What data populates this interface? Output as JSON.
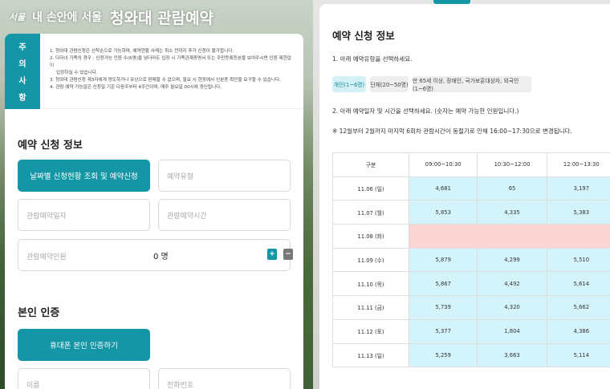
{
  "header": {
    "logo_mark": "서울",
    "logo_text": "내 손안에 서울",
    "page_title": "청와대 관람예약"
  },
  "notice": {
    "tab_chars": [
      "주",
      "의",
      "사",
      "항"
    ],
    "items": [
      "1. 청와대 관람신청은 선착순으로 가능하며, 예약현황 사례는 취소 전까지 추가 신청이 불가합니다.",
      "2. 다자녀 가족의 경우 : 신청가능 인원 수(6명)을 넘더라도 입장 시 가족관계증명서 또는 주민등록등본을 보여주시면 인원 제한없이",
      "입장하실 수 있습니다.",
      "3. 청와대 관람신청 제3자에게 양도하거나 유상으로 판매할 수 없으며, 필요 시 현장에서 신분증 확인을 요구할 수 있습니다.",
      "4. 관람 예약 가능일은 신청일 기준 다음주부터 4주간이며, 매주 월요일 00시에 갱신됩니다."
    ]
  },
  "left_form": {
    "section_title": "예약 신청 정보",
    "schedule_button": "날짜별 신청현황 조회 및 예약신청",
    "type_placeholder": "예약유형",
    "date_placeholder": "관람예약일자",
    "time_placeholder": "관람예약시간",
    "count_label": "관람예약인원",
    "count_value": "0 명",
    "plus": "+",
    "minus": "−",
    "auth_title": "본인 인증",
    "auth_button": "휴대폰 본인 인증하기",
    "name_placeholder": "이름",
    "phone_placeholder": "전화번호"
  },
  "right_panel": {
    "title": "예약 신청 정보",
    "step1": "1. 아래 예약유형을 선택하세요.",
    "types": [
      {
        "label": "개인(1~6명)",
        "selected": true
      },
      {
        "label": "단체(20~50명)",
        "selected": false
      },
      {
        "label": "만 65세 이상, 장애인, 국가보훈대상자, 외국인(1~6명)",
        "selected": false
      }
    ],
    "step2": "2. 아래 예약일자 및 시간을 선택하세요. (숫자는 예약 가능한 인원입니다.)",
    "notice": "※ 12월부터 2월까지 마지막 6회차 관람시간이 동절기로 인해 16:00~17:30으로 변경됩니다.",
    "table": {
      "headers": [
        "구분",
        "09:00~10:30",
        "10:30~12:00",
        "12:00~13:30"
      ],
      "rows": [
        {
          "date": "11.06 (일)",
          "values": [
            "4,681",
            "65",
            "3,197"
          ],
          "closed": false
        },
        {
          "date": "11.07 (월)",
          "values": [
            "5,853",
            "4,335",
            "5,383"
          ],
          "closed": false
        },
        {
          "date": "11.08 (화)",
          "values": [
            "",
            "",
            ""
          ],
          "closed": true
        },
        {
          "date": "11.09 (수)",
          "values": [
            "5,879",
            "4,299",
            "5,510"
          ],
          "closed": false
        },
        {
          "date": "11.10 (목)",
          "values": [
            "5,867",
            "4,492",
            "5,614"
          ],
          "closed": false
        },
        {
          "date": "11.11 (금)",
          "values": [
            "5,739",
            "4,320",
            "5,662"
          ],
          "closed": false
        },
        {
          "date": "11.12 (토)",
          "values": [
            "5,377",
            "1,804",
            "4,386"
          ],
          "closed": false
        },
        {
          "date": "11.13 (일)",
          "values": [
            "5,259",
            "3,663",
            "5,114"
          ],
          "closed": false
        }
      ]
    }
  },
  "colors": {
    "accent": "#1596a6",
    "open_cell": "#d4f4fb",
    "closed_cell": "#fbd4d4"
  }
}
